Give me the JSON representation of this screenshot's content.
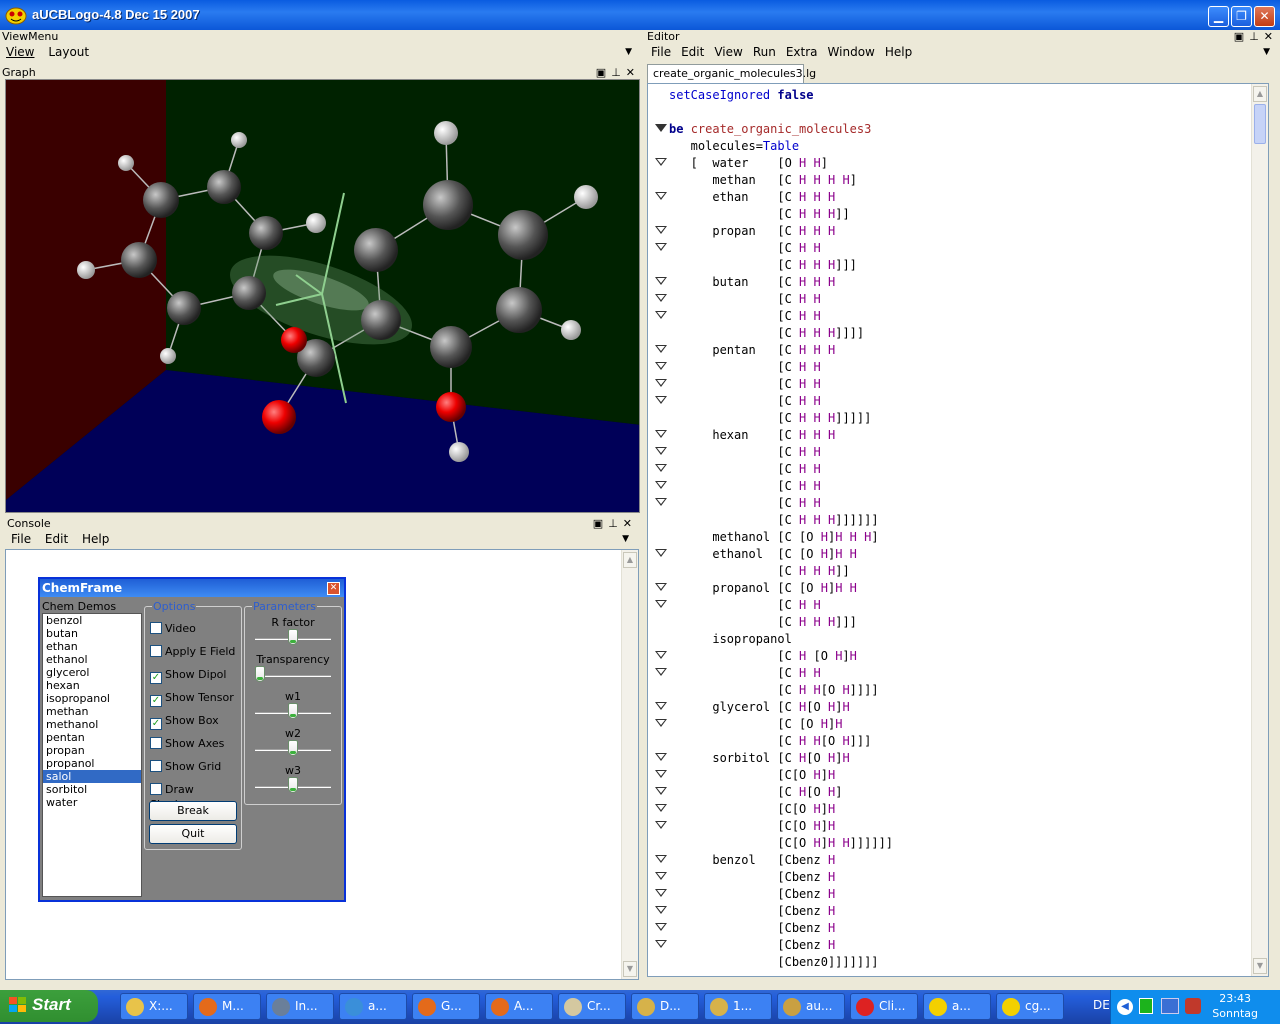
{
  "window": {
    "title": "aUCBLogo-4.8 Dec 15 2007",
    "min": "▁",
    "max": "❐",
    "close": "✕"
  },
  "viewmenu": {
    "title": "ViewMenu",
    "items": [
      "View",
      "Layout"
    ]
  },
  "graph": {
    "title": "Graph"
  },
  "console": {
    "title": "Console",
    "menu": [
      "File",
      "Edit",
      "Help"
    ]
  },
  "chemframe": {
    "title": "ChemFrame",
    "list_title": "Chem Demos",
    "items": [
      "benzol",
      "butan",
      "ethan",
      "ethanol",
      "glycerol",
      "hexan",
      "isopropanol",
      "methan",
      "methanol",
      "pentan",
      "propan",
      "propanol",
      "salol",
      "sorbitol",
      "water"
    ],
    "selected": "salol",
    "options_title": "Options",
    "options": [
      {
        "label": "Video",
        "checked": false
      },
      {
        "label": "Apply E Field",
        "checked": false
      },
      {
        "label": "Show Dipol",
        "checked": true
      },
      {
        "label": "Show Tensor",
        "checked": true
      },
      {
        "label": "Show Box",
        "checked": true
      },
      {
        "label": "Show Axes",
        "checked": false
      },
      {
        "label": "Show Grid",
        "checked": false
      },
      {
        "label": "Draw Shadows",
        "checked": false
      }
    ],
    "buttons": [
      "Break",
      "Quit"
    ],
    "params_title": "Parameters",
    "params": [
      {
        "label": "R factor",
        "value": 0.5
      },
      {
        "label": "Transparency",
        "value": 0.0
      },
      {
        "label": "w1",
        "value": 0.5
      },
      {
        "label": "w2",
        "value": 0.5
      },
      {
        "label": "w3",
        "value": 0.5
      }
    ]
  },
  "editor": {
    "title": "Editor",
    "menu": [
      "File",
      "Edit",
      "View",
      "Run",
      "Extra",
      "Window",
      "Help"
    ],
    "tab": "create_organic_molecules3.lg",
    "lines": [
      {
        "f": "",
        "t": "setCaseIgnored false"
      },
      {
        "f": "",
        "t": ""
      },
      {
        "f": "open",
        "t": "be create_organic_molecules3"
      },
      {
        "f": "",
        "t": "   molecules=Table"
      },
      {
        "f": "h",
        "t": "   [  water    [O H H]"
      },
      {
        "f": "",
        "t": "      methan   [C H H H H]"
      },
      {
        "f": "h",
        "t": "      ethan    [C H H H"
      },
      {
        "f": "",
        "t": "               [C H H H]]"
      },
      {
        "f": "h",
        "t": "      propan   [C H H H"
      },
      {
        "f": "h",
        "t": "               [C H H"
      },
      {
        "f": "",
        "t": "               [C H H H]]]"
      },
      {
        "f": "h",
        "t": "      butan    [C H H H"
      },
      {
        "f": "h",
        "t": "               [C H H"
      },
      {
        "f": "h",
        "t": "               [C H H"
      },
      {
        "f": "",
        "t": "               [C H H H]]]]"
      },
      {
        "f": "h",
        "t": "      pentan   [C H H H"
      },
      {
        "f": "h",
        "t": "               [C H H"
      },
      {
        "f": "h",
        "t": "               [C H H"
      },
      {
        "f": "h",
        "t": "               [C H H"
      },
      {
        "f": "",
        "t": "               [C H H H]]]]]"
      },
      {
        "f": "h",
        "t": "      hexan    [C H H H"
      },
      {
        "f": "h",
        "t": "               [C H H"
      },
      {
        "f": "h",
        "t": "               [C H H"
      },
      {
        "f": "h",
        "t": "               [C H H"
      },
      {
        "f": "h",
        "t": "               [C H H"
      },
      {
        "f": "",
        "t": "               [C H H H]]]]]]"
      },
      {
        "f": "",
        "t": "      methanol [C [O H]H H H]"
      },
      {
        "f": "h",
        "t": "      ethanol  [C [O H]H H"
      },
      {
        "f": "",
        "t": "               [C H H H]]"
      },
      {
        "f": "h",
        "t": "      propanol [C [O H]H H"
      },
      {
        "f": "h",
        "t": "               [C H H"
      },
      {
        "f": "",
        "t": "               [C H H H]]]"
      },
      {
        "f": "",
        "t": "      isopropanol"
      },
      {
        "f": "h",
        "t": "               [C H [O H]H"
      },
      {
        "f": "h",
        "t": "               [C H H"
      },
      {
        "f": "",
        "t": "               [C H H[O H]]]]"
      },
      {
        "f": "h",
        "t": "      glycerol [C H[O H]H"
      },
      {
        "f": "h",
        "t": "               [C [O H]H"
      },
      {
        "f": "",
        "t": "               [C H H[O H]]]"
      },
      {
        "f": "h",
        "t": "      sorbitol [C H[O H]H"
      },
      {
        "f": "h",
        "t": "               [C[O H]H"
      },
      {
        "f": "h",
        "t": "               [C H[O H]"
      },
      {
        "f": "h",
        "t": "               [C[O H]H"
      },
      {
        "f": "h",
        "t": "               [C[O H]H"
      },
      {
        "f": "",
        "t": "               [C[O H]H H]]]]]]"
      },
      {
        "f": "h",
        "t": "      benzol   [Cbenz H"
      },
      {
        "f": "h",
        "t": "               [Cbenz H"
      },
      {
        "f": "h",
        "t": "               [Cbenz H"
      },
      {
        "f": "h",
        "t": "               [Cbenz H"
      },
      {
        "f": "h",
        "t": "               [Cbenz H"
      },
      {
        "f": "h",
        "t": "               [Cbenz H"
      },
      {
        "f": "",
        "t": "               [Cbenz0]]]]]]]"
      }
    ]
  },
  "taskbar": {
    "start": "Start",
    "items": [
      "X:...",
      "M...",
      "In...",
      "a...",
      "G...",
      "A...",
      "Cr...",
      "D...",
      "1...",
      "au...",
      "Cli...",
      "a...",
      "cg..."
    ],
    "lang": "DE",
    "time": "23:43",
    "day": "Sonntag"
  }
}
